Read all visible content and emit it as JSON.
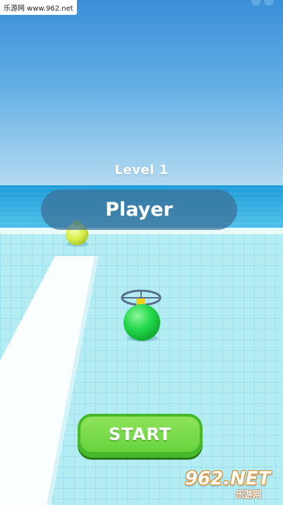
{
  "watermark": {
    "text": "乐游网 www.962.net"
  },
  "level": {
    "label": "Level 1"
  },
  "player_name": {
    "value": "Player"
  },
  "start_button": {
    "label": "START"
  },
  "logo": {
    "main": "962.NET",
    "sub": "乐游网"
  },
  "colors": {
    "player_ball": "#22d84a",
    "enemy_ball": "#d8ee4a",
    "button": "#66d33d",
    "name_bar": "#3c6e96"
  }
}
